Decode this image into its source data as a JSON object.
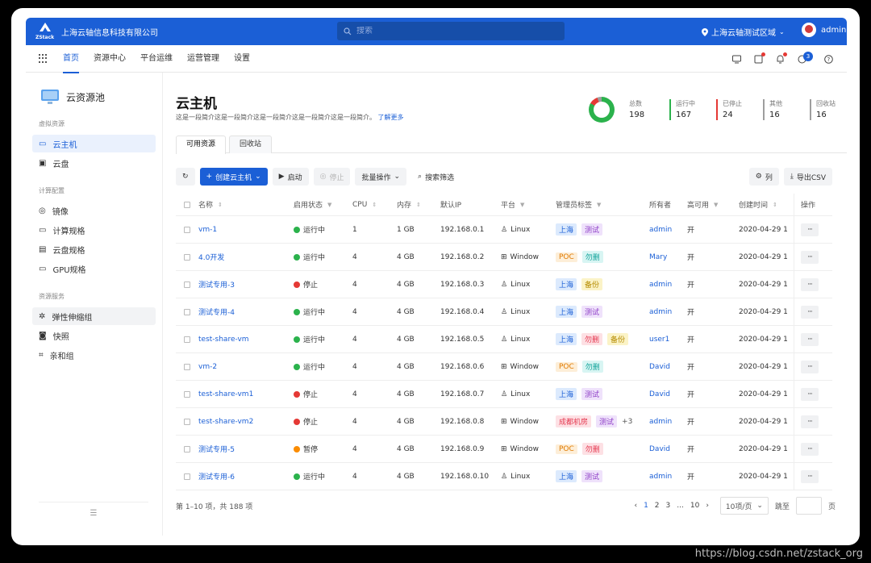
{
  "header": {
    "company": "上海云轴信息科技有限公司",
    "logo_text": "ZStack",
    "search_placeholder": "搜索",
    "region": "上海云轴测试区域",
    "user": "admin"
  },
  "nav": {
    "items": [
      "首页",
      "资源中心",
      "平台运维",
      "运营管理",
      "设置"
    ],
    "active": "首页",
    "notification_count": "3"
  },
  "sidebar": {
    "title": "云资源池",
    "groups": [
      {
        "label": "虚拟资源",
        "items": [
          {
            "label": "云主机",
            "icon": "monitor-icon"
          },
          {
            "label": "云盘",
            "icon": "disk-icon"
          }
        ]
      },
      {
        "label": "计算配置",
        "items": [
          {
            "label": "镜像",
            "icon": "image-icon"
          },
          {
            "label": "计算规格",
            "icon": "compute-spec-icon"
          },
          {
            "label": "云盘规格",
            "icon": "disk-spec-icon"
          },
          {
            "label": "GPU规格",
            "icon": "gpu-icon"
          }
        ]
      },
      {
        "label": "资源服务",
        "items": [
          {
            "label": "弹性伸缩组",
            "icon": "autoscale-icon"
          },
          {
            "label": "快照",
            "icon": "camera-icon"
          },
          {
            "label": "亲和组",
            "icon": "affinity-icon"
          }
        ]
      }
    ],
    "collapse_symbol": "☰"
  },
  "page": {
    "title": "云主机",
    "subtitle": "这是一段简介这是一段简介这是一段简介这是一段简介这是一段简介。",
    "learn_more": "了解更多",
    "tabs": [
      "可用资源",
      "回收站"
    ]
  },
  "stats": [
    {
      "label": "总数",
      "value": "198",
      "color": "#2bb24c"
    },
    {
      "label": "运行中",
      "value": "167",
      "color": "#2bb24c"
    },
    {
      "label": "已停止",
      "value": "24",
      "color": "#e53935"
    },
    {
      "label": "其他",
      "value": "16",
      "color": "#9e9e9e"
    },
    {
      "label": "回收站",
      "value": "16",
      "color": "#9e9e9e"
    }
  ],
  "toolbar": {
    "create": "创建云主机",
    "start": "启动",
    "stop": "停止",
    "batch": "批量操作",
    "filter": "搜索筛选",
    "columns": "列",
    "export": "导出CSV"
  },
  "table": {
    "headers": [
      "名称",
      "启用状态",
      "CPU",
      "内存",
      "默认IP",
      "平台",
      "管理员标签",
      "所有者",
      "高可用",
      "创建时间",
      "操作"
    ],
    "rows": [
      {
        "name": "vm-1",
        "status": "运行中",
        "status_type": "run",
        "cpu": "1",
        "mem": "1 GB",
        "ip": "192.168.0.1",
        "platform": "Linux",
        "tags": [
          {
            "t": "上海",
            "c": "blue"
          },
          {
            "t": "测试",
            "c": "purple"
          }
        ],
        "extra": "",
        "owner": "admin",
        "ha": "开",
        "date": "2020-04-29 1"
      },
      {
        "name": "4.0开发",
        "status": "运行中",
        "status_type": "run",
        "cpu": "4",
        "mem": "4 GB",
        "ip": "192.168.0.2",
        "platform": "Window",
        "tags": [
          {
            "t": "POC",
            "c": "orange"
          },
          {
            "t": "勿删",
            "c": "cyan"
          }
        ],
        "extra": "",
        "owner": "Mary",
        "ha": "开",
        "date": "2020-04-29 1"
      },
      {
        "name": "测试专用-3",
        "status": "停止",
        "status_type": "stop",
        "cpu": "4",
        "mem": "4 GB",
        "ip": "192.168.0.3",
        "platform": "Linux",
        "tags": [
          {
            "t": "上海",
            "c": "blue"
          },
          {
            "t": "备份",
            "c": "yellow"
          }
        ],
        "extra": "",
        "owner": "admin",
        "ha": "开",
        "date": "2020-04-29 1"
      },
      {
        "name": "测试专用-4",
        "status": "运行中",
        "status_type": "run",
        "cpu": "4",
        "mem": "4 GB",
        "ip": "192.168.0.4",
        "platform": "Linux",
        "tags": [
          {
            "t": "上海",
            "c": "blue"
          },
          {
            "t": "测试",
            "c": "purple"
          }
        ],
        "extra": "",
        "owner": "admin",
        "ha": "开",
        "date": "2020-04-29 1"
      },
      {
        "name": "test-share-vm",
        "status": "运行中",
        "status_type": "run",
        "cpu": "4",
        "mem": "4 GB",
        "ip": "192.168.0.5",
        "platform": "Linux",
        "tags": [
          {
            "t": "上海",
            "c": "blue"
          },
          {
            "t": "勿删",
            "c": "pink"
          },
          {
            "t": "备份",
            "c": "yellow"
          }
        ],
        "extra": "",
        "owner": "user1",
        "ha": "开",
        "date": "2020-04-29 1"
      },
      {
        "name": "vm-2",
        "status": "运行中",
        "status_type": "run",
        "cpu": "4",
        "mem": "4 GB",
        "ip": "192.168.0.6",
        "platform": "Window",
        "tags": [
          {
            "t": "POC",
            "c": "orange"
          },
          {
            "t": "勿删",
            "c": "cyan"
          }
        ],
        "extra": "",
        "owner": "David",
        "ha": "开",
        "date": "2020-04-29 1"
      },
      {
        "name": "test-share-vm1",
        "status": "停止",
        "status_type": "stop",
        "cpu": "4",
        "mem": "4 GB",
        "ip": "192.168.0.7",
        "platform": "Linux",
        "tags": [
          {
            "t": "上海",
            "c": "blue"
          },
          {
            "t": "测试",
            "c": "purple"
          }
        ],
        "extra": "",
        "owner": "David",
        "ha": "开",
        "date": "2020-04-29 1"
      },
      {
        "name": "test-share-vm2",
        "status": "停止",
        "status_type": "stop",
        "cpu": "4",
        "mem": "4 GB",
        "ip": "192.168.0.8",
        "platform": "Window",
        "tags": [
          {
            "t": "成都机房",
            "c": "pink"
          },
          {
            "t": "测试",
            "c": "purple"
          }
        ],
        "extra": "+3",
        "owner": "admin",
        "ha": "开",
        "date": "2020-04-29 1"
      },
      {
        "name": "测试专用-5",
        "status": "暂停",
        "status_type": "pause",
        "cpu": "4",
        "mem": "4 GB",
        "ip": "192.168.0.9",
        "platform": "Window",
        "tags": [
          {
            "t": "POC",
            "c": "orange"
          },
          {
            "t": "勿删",
            "c": "pink"
          }
        ],
        "extra": "",
        "owner": "David",
        "ha": "开",
        "date": "2020-04-29 1"
      },
      {
        "name": "测试专用-6",
        "status": "运行中",
        "status_type": "run",
        "cpu": "4",
        "mem": "4 GB",
        "ip": "192.168.0.10",
        "platform": "Linux",
        "tags": [
          {
            "t": "上海",
            "c": "blue"
          },
          {
            "t": "测试",
            "c": "purple"
          }
        ],
        "extra": "",
        "owner": "admin",
        "ha": "开",
        "date": "2020-04-29 1"
      }
    ],
    "op_label": "···"
  },
  "pagination": {
    "summary": "第 1–10 项，共 188 项",
    "pages": [
      "1",
      "2",
      "3",
      "...",
      "10"
    ],
    "active_page": "1",
    "page_size": "10项/页",
    "jump_label": "跳至",
    "page_suffix": "页"
  },
  "watermark": "https://blog.csdn.net/zstack_org"
}
